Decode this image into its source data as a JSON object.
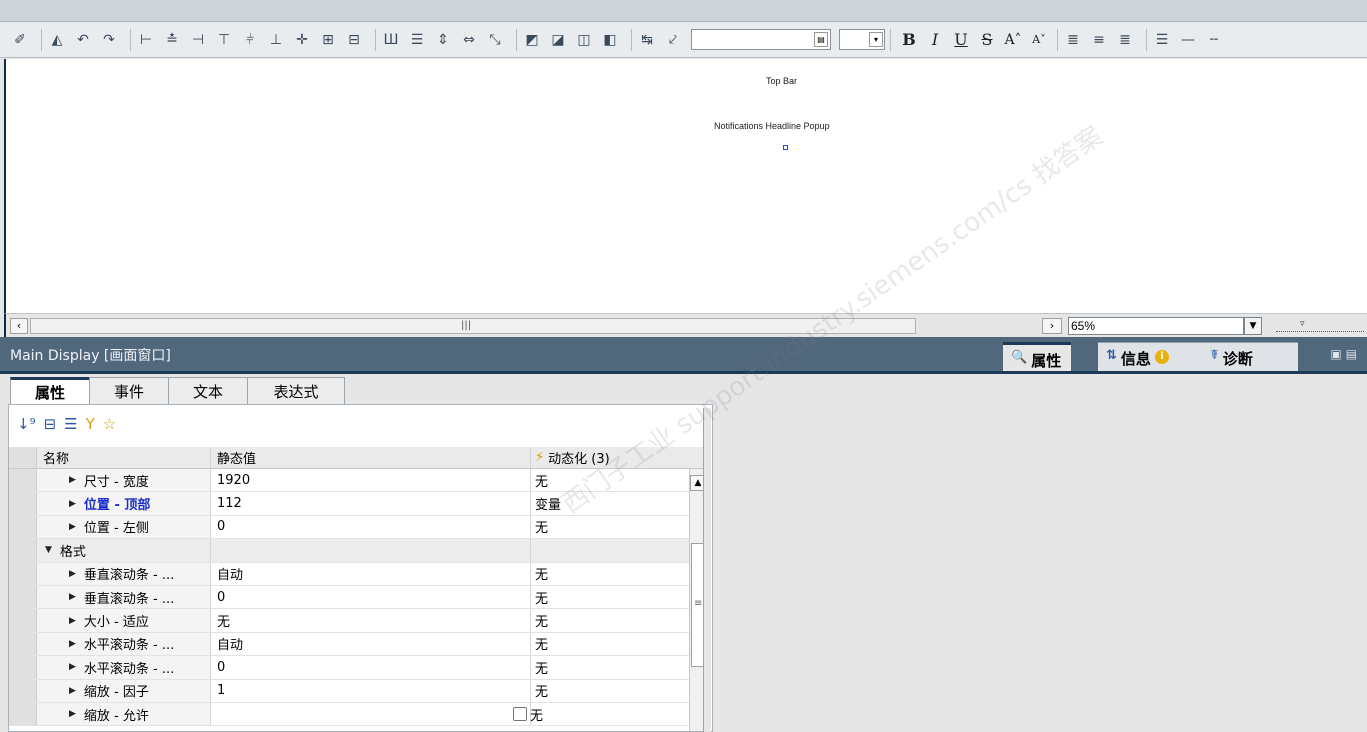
{
  "canvas": {
    "label_top_bar": "Top Bar",
    "label_popup": "Notifications Headline Popup"
  },
  "toolbar": {
    "format_buttons": [
      "B",
      "I",
      "U",
      "S",
      "A˄",
      "A˅"
    ]
  },
  "hscroll": {
    "zoom_value": "65%"
  },
  "panel": {
    "title": "Main Display [画面窗口]",
    "right_tabs": [
      {
        "label": "属性",
        "icon": "properties-icon"
      },
      {
        "label": "信息",
        "icon": "info-icon"
      },
      {
        "label": "诊断",
        "icon": "diagnostics-icon"
      }
    ]
  },
  "subtabs": [
    "属性",
    "事件",
    "文本",
    "表达式"
  ],
  "grid": {
    "headers": {
      "name": "名称",
      "static": "静态值",
      "dynamic": "动态化 (3)"
    },
    "rows": [
      {
        "name": "尺寸 - 宽度",
        "static": "1920",
        "dynamic": "无"
      },
      {
        "name": "位置 - 顶部",
        "static": "112",
        "dynamic": "变量"
      },
      {
        "name": "位置 - 左侧",
        "static": "0",
        "dynamic": "无"
      },
      {
        "name": "格式",
        "static": "",
        "dynamic": ""
      },
      {
        "name": "垂直滚动条 - ...",
        "static": "自动",
        "dynamic": "无"
      },
      {
        "name": "垂直滚动条 - ...",
        "static": "0",
        "dynamic": "无"
      },
      {
        "name": "大小 - 适应",
        "static": "无",
        "dynamic": "无"
      },
      {
        "name": "水平滚动条 - ...",
        "static": "自动",
        "dynamic": "无"
      },
      {
        "name": "水平滚动条 - ...",
        "static": "0",
        "dynamic": "无"
      },
      {
        "name": "缩放 - 因子",
        "static": "1",
        "dynamic": "无"
      },
      {
        "name": "缩放 - 允许",
        "static": "",
        "dynamic": "无"
      }
    ]
  },
  "watermark": "西门子工业 support.industry.siemens.com/cs 找答案"
}
